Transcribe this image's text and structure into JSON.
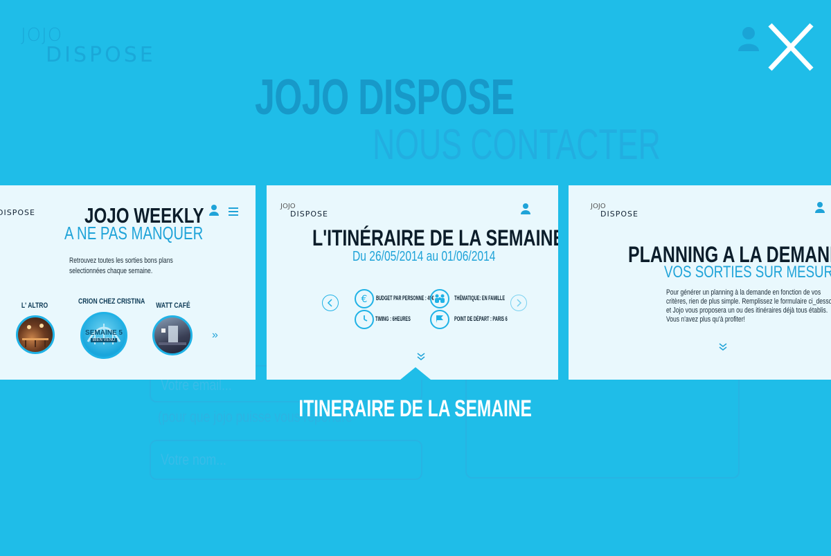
{
  "background": {
    "logo_line1": "JOJO",
    "logo_line2": "DISPOSE",
    "title": "JOJO DISPOSE",
    "subtitle": "NOUS CONTACTER",
    "field_email": "Votre email...",
    "email_hint": "(pour que jojo puisse vous répondre",
    "field_name": "Votre nom..."
  },
  "cards": {
    "left": {
      "logo_line1": "JOJO",
      "logo_line2": "DISPOSE",
      "title": "JOJO WEEKLY",
      "subtitle": "A NE PAS MANQUER",
      "description_1": "Retrouvez toutes les sorties bons plans",
      "description_2": "selectionnées chaque semaine.",
      "venues": [
        {
          "label": "L' ALTRO",
          "icon": "venue-photo"
        },
        {
          "label": "CRION CHEZ CRISTINA",
          "badge": "SEMAINE 5",
          "badge_sub": "BIEN VENU"
        },
        {
          "label": "WATT CAFÉ",
          "icon": "venue-photo"
        }
      ]
    },
    "center": {
      "logo_line1": "JOJO",
      "logo_line2": "DISPOSE",
      "title": "L'ITINÉRAIRE DE LA SEMAINE",
      "dates": "Du 26/05/2014 au 01/06/2014",
      "info": {
        "budget": "BUDGET PAR PERSONNE : 49€",
        "theme": "THÉMATIQUE: EN FAMILLE",
        "timing": "TIMING : 6HEURES",
        "start": "POINT DE DÉPART : PARIS 6"
      }
    },
    "right": {
      "logo_line1": "JOJO",
      "logo_line2": "DISPOSE",
      "title": "PLANNING A LA DEMANDE",
      "subtitle": "VOS SORTIES SUR MESURE",
      "description_1": "Pour générer un planning à la demande en fonction de vos",
      "description_2": "critères, rien de plus simple. Remplissez le formulaire ci_dessous",
      "description_3": "et Jojo vous proposera un ou des itinéraires déjà tous établis.",
      "description_4": "Vous n'avez plus qu'à profiter!"
    }
  },
  "caption": "ITINERAIRE DE LA SEMAINE",
  "colors": {
    "background": "#1fbde8",
    "card": "#e9f8fd",
    "accent": "#1fb2e6",
    "text_dark": "#0c1d2a"
  }
}
